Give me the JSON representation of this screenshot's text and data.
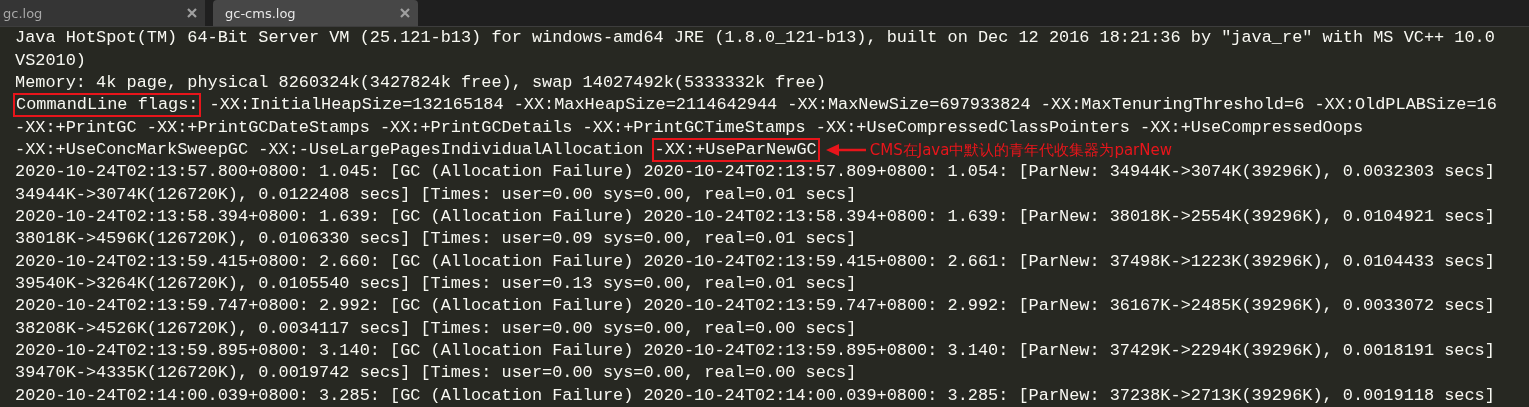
{
  "tabs": [
    {
      "label": "gc.log",
      "selected": false
    },
    {
      "label": "gc-cms.log",
      "selected": true
    }
  ],
  "lines": [
    {
      "segments": [
        {
          "text": "Java HotSpot(TM) 64-Bit Server VM (25.121-b13) for windows-amd64 JRE (1.8.0_121-b13), built on Dec 12 2016 18:21:36 by \"java_re\" with MS VC++ 10.0",
          "boxed": false
        }
      ]
    },
    {
      "segments": [
        {
          "text": "VS2010)",
          "boxed": false
        }
      ]
    },
    {
      "segments": [
        {
          "text": "Memory: 4k page, physical 8260324k(3427824k free), swap 14027492k(5333332k free)",
          "boxed": false
        }
      ]
    },
    {
      "segments": [
        {
          "text": "CommandLine flags:",
          "boxed": true
        },
        {
          "text": " -XX:InitialHeapSize=132165184 -XX:MaxHeapSize=2114642944 -XX:MaxNewSize=697933824 -XX:MaxTenuringThreshold=6 -XX:OldPLABSize=16",
          "boxed": false
        }
      ]
    },
    {
      "segments": [
        {
          "text": "-XX:+PrintGC -XX:+PrintGCDateStamps -XX:+PrintGCDetails -XX:+PrintGCTimeStamps -XX:+UseCompressedClassPointers -XX:+UseCompressedOops",
          "boxed": false
        }
      ]
    },
    {
      "segments": [
        {
          "text": "-XX:+UseConcMarkSweepGC -XX:-UseLargePagesIndividualAllocation ",
          "boxed": false
        },
        {
          "text": "-XX:+UseParNewGC",
          "boxed": true
        }
      ],
      "note": "CMS在Java中默认的青年代收集器为parNew"
    },
    {
      "segments": [
        {
          "text": "2020-10-24T02:13:57.800+0800: 1.045: [GC (Allocation Failure) 2020-10-24T02:13:57.809+0800: 1.054: [ParNew: 34944K->3074K(39296K), 0.0032303 secs]",
          "boxed": false
        }
      ]
    },
    {
      "segments": [
        {
          "text": "34944K->3074K(126720K), 0.0122408 secs] [Times: user=0.00 sys=0.00, real=0.01 secs]",
          "boxed": false
        }
      ]
    },
    {
      "segments": [
        {
          "text": "2020-10-24T02:13:58.394+0800: 1.639: [GC (Allocation Failure) 2020-10-24T02:13:58.394+0800: 1.639: [ParNew: 38018K->2554K(39296K), 0.0104921 secs]",
          "boxed": false
        }
      ]
    },
    {
      "segments": [
        {
          "text": "38018K->4596K(126720K), 0.0106330 secs] [Times: user=0.09 sys=0.00, real=0.01 secs]",
          "boxed": false
        }
      ]
    },
    {
      "segments": [
        {
          "text": "2020-10-24T02:13:59.415+0800: 2.660: [GC (Allocation Failure) 2020-10-24T02:13:59.415+0800: 2.661: [ParNew: 37498K->1223K(39296K), 0.0104433 secs]",
          "boxed": false
        }
      ]
    },
    {
      "segments": [
        {
          "text": "39540K->3264K(126720K), 0.0105540 secs] [Times: user=0.13 sys=0.00, real=0.01 secs]",
          "boxed": false
        }
      ]
    },
    {
      "segments": [
        {
          "text": "2020-10-24T02:13:59.747+0800: 2.992: [GC (Allocation Failure) 2020-10-24T02:13:59.747+0800: 2.992: [ParNew: 36167K->2485K(39296K), 0.0033072 secs]",
          "boxed": false
        }
      ]
    },
    {
      "segments": [
        {
          "text": "38208K->4526K(126720K), 0.0034117 secs] [Times: user=0.00 sys=0.00, real=0.00 secs]",
          "boxed": false
        }
      ]
    },
    {
      "segments": [
        {
          "text": "2020-10-24T02:13:59.895+0800: 3.140: [GC (Allocation Failure) 2020-10-24T02:13:59.895+0800: 3.140: [ParNew: 37429K->2294K(39296K), 0.0018191 secs]",
          "boxed": false
        }
      ]
    },
    {
      "segments": [
        {
          "text": "39470K->4335K(126720K), 0.0019742 secs] [Times: user=0.00 sys=0.00, real=0.00 secs]",
          "boxed": false
        }
      ]
    },
    {
      "segments": [
        {
          "text": "2020-10-24T02:14:00.039+0800: 3.285: [GC (Allocation Failure) 2020-10-24T02:14:00.039+0800: 3.285: [ParNew: 37238K->2713K(39296K), 0.0019118 secs]",
          "boxed": false
        }
      ]
    }
  ]
}
